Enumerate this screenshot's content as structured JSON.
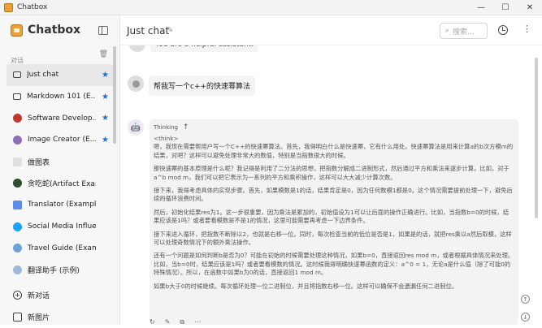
{
  "window": {
    "title": "Chatbox",
    "controls": [
      "—",
      "☐",
      "✕"
    ]
  },
  "sidebar": {
    "brand": "Chatbox",
    "section_label": "对话",
    "conversations": [
      {
        "label": "Just chat",
        "icon": "chat-icon",
        "starred": true,
        "active": true
      },
      {
        "label": "Markdown 101 (E...",
        "icon": "chat-icon",
        "starred": true
      },
      {
        "label": "Software Develop...",
        "icon": "developer-avatar",
        "starred": true
      },
      {
        "label": "Image Creator (E...",
        "icon": "image-creator-avatar",
        "starred": true
      },
      {
        "label": "做图表",
        "icon": "chart-avatar",
        "starred": false
      },
      {
        "label": "贪吃蛇(Artifact Example)",
        "icon": "snake-avatar",
        "starred": false
      },
      {
        "label": "Translator (Example)",
        "icon": "translator-avatar",
        "starred": false
      },
      {
        "label": "Social Media Influence...",
        "icon": "twitter-avatar",
        "starred": false
      },
      {
        "label": "Travel Guide (Example)",
        "icon": "travel-avatar",
        "starred": false
      },
      {
        "label": "翻译助手 (示例)",
        "icon": "translate-avatar",
        "starred": false
      }
    ],
    "actions": [
      {
        "label": "新对话",
        "icon": "plus-circle-icon"
      },
      {
        "label": "新图片",
        "icon": "image-icon"
      }
    ]
  },
  "header": {
    "title": "Just chat",
    "search_placeholder": "搜索..."
  },
  "messages": {
    "system_partial": "You are a helpful assistant.",
    "user": "帮我写一个c++的快速幂算法",
    "thinking_label": "Thinking",
    "thinking_paragraphs": [
      "<think>\n嗯，我现在需要帮用户写一个C++的快速幂算法。首先，我得明白什么是快速幂，它有什么用处。快速幂算法是用来计算a的b次方模m的结果，对吧？这样可以避免处理非常大的数值，特别是当指数很大的时候。",
      "那快速幂的基本原理是什么呢？我记得是利用了二分法的思想，把指数分解成二进制形式，然后通过平方和乘法来逐步计算。比如，对于a^b mod m，我们可以把它表示为一系列的平方和乘积操作，这样可以大大减少计算次数。",
      "接下来，我得考虑具体的实现步骤。首先，如果模数是1的话，结果肯定是0，因为任何数模1都是0。这个情况需要提前处理一下，避免后续的循环浪费时间。",
      "然后，初始化结果res为1。这一步很重要，因为乘法是累加的，初始值设为1可以让后面的操作正确进行。比如，当指数b=0的时候，结果应该是1吗？或者要看模数是不是1的情况，这里可能需要再考虑一下边界条件。",
      "接下来进入循环，把指数不断除以2，也就是右移一位。同时，每次检查当前的低位是否是1，如果是的话，就把res乘以a然后取模，这样可以处理奇数情况下的额外乘法操作。",
      "还有一个问题是如何判断b是否为0？可能在初始的时候需要处理这种情况，如果b=0，直接返回res mod m，或者根据具体情况来处理。比如，当b=0时，结果应该是1吗？或者要看模数的情况。这时候我得明确快速幂函数的定义：a^0 = 1，无论a是什么值（除了可能0的特殊情况）。所以，在函数中如果b为0的话，直接返回1 mod m。",
      "如果b大于0的时候继续。每次循环处理一位二进制位，并且将指数右移一位。这样可以确保不会遗漏任何二进制位。"
    ]
  }
}
